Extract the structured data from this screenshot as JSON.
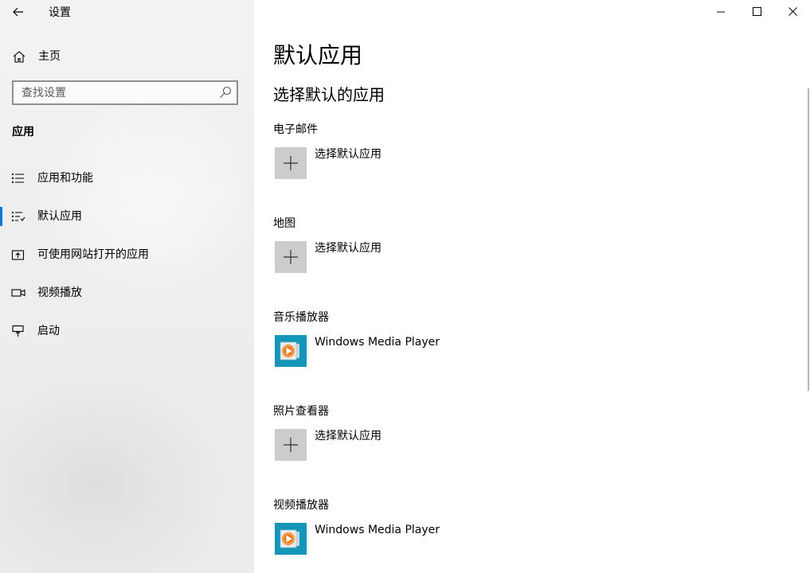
{
  "window": {
    "title": "设置"
  },
  "sidebar": {
    "home_label": "主页",
    "search_placeholder": "查找设置",
    "section_heading": "应用",
    "items": [
      {
        "label": "应用和功能",
        "icon": "apps-features-icon",
        "selected": false
      },
      {
        "label": "默认应用",
        "icon": "default-apps-icon",
        "selected": true
      },
      {
        "label": "可使用网站打开的应用",
        "icon": "apps-for-websites-icon",
        "selected": false
      },
      {
        "label": "视频播放",
        "icon": "video-playback-icon",
        "selected": false
      },
      {
        "label": "启动",
        "icon": "startup-icon",
        "selected": false
      }
    ]
  },
  "main": {
    "page_title": "默认应用",
    "sub_title": "选择默认的应用",
    "categories": [
      {
        "label": "电子邮件",
        "choice": "选择默认应用",
        "icon": "plus-icon"
      },
      {
        "label": "地图",
        "choice": "选择默认应用",
        "icon": "plus-icon"
      },
      {
        "label": "音乐播放器",
        "choice": "Windows Media Player",
        "icon": "windows-media-player-icon"
      },
      {
        "label": "照片查看器",
        "choice": "选择默认应用",
        "icon": "plus-icon"
      },
      {
        "label": "视频播放器",
        "choice": "Windows Media Player",
        "icon": "windows-media-player-icon"
      }
    ]
  },
  "colors": {
    "accent": "#0078d7",
    "tile_empty": "#cccccc",
    "tile_wmp": "#0f8fb0"
  }
}
